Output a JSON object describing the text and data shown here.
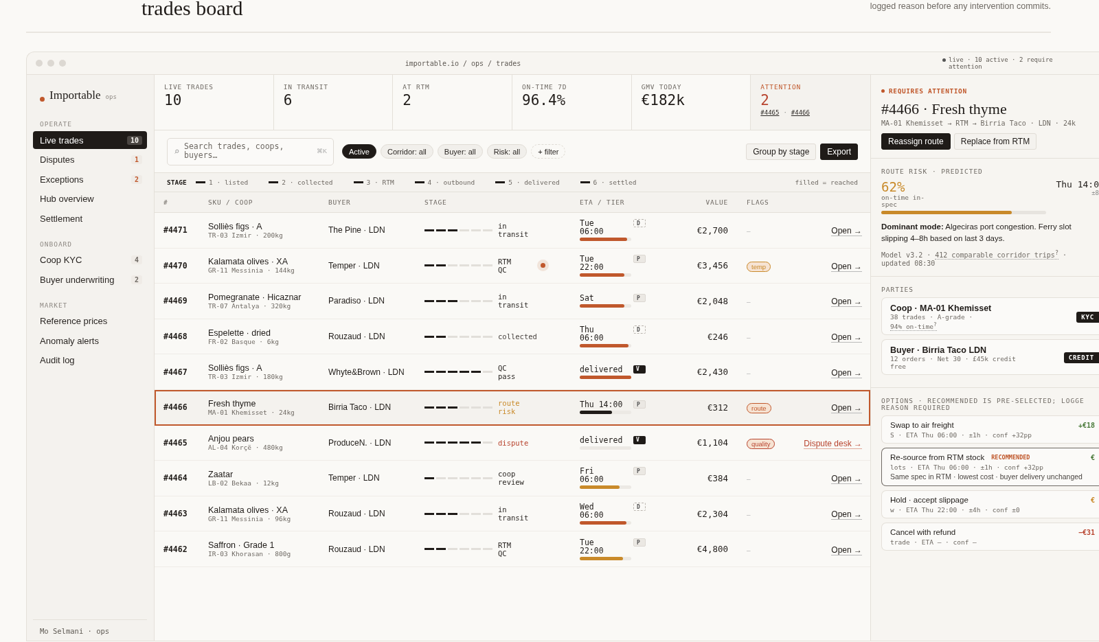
{
  "page": {
    "heading": "trades board",
    "note": "logged reason before any intervention commits."
  },
  "window": {
    "address": "importable.io / ops / trades",
    "status": "live · 10 active · 2 require attention"
  },
  "sidebar": {
    "brand": "Importable",
    "brand_tag": "ops",
    "sections": [
      {
        "title": "OPERATE",
        "items": [
          {
            "label": "Live trades",
            "count": "10",
            "selected": true
          },
          {
            "label": "Disputes",
            "count": "1",
            "color": "#c0582c",
            "selected": false
          },
          {
            "label": "Exceptions",
            "count": "2",
            "color": "#c0582c",
            "selected": false
          },
          {
            "label": "Hub overview",
            "selected": false
          },
          {
            "label": "Settlement",
            "selected": false
          }
        ]
      },
      {
        "title": "ONBOARD",
        "items": [
          {
            "label": "Coop KYC",
            "count": "4",
            "color": "#6f6a64",
            "selected": false
          },
          {
            "label": "Buyer underwriting",
            "count": "2",
            "color": "#6f6a64",
            "selected": false
          }
        ]
      },
      {
        "title": "MARKET",
        "items": [
          {
            "label": "Reference prices",
            "selected": false
          },
          {
            "label": "Anomaly alerts",
            "selected": false
          },
          {
            "label": "Audit log",
            "selected": false
          }
        ]
      }
    ],
    "user": "Mo Selmani · ops"
  },
  "kpis": [
    {
      "label": "LIVE TRADES",
      "value": "10",
      "kind": "normal"
    },
    {
      "label": "IN TRANSIT",
      "value": "6",
      "kind": "normal"
    },
    {
      "label": "AT RTM",
      "value": "2",
      "kind": "normal"
    },
    {
      "label": "ON-TIME 7D",
      "value": "96.4%",
      "kind": "normal"
    },
    {
      "label": "GMV TODAY",
      "value": "€182k",
      "kind": "normal"
    },
    {
      "label": "ATTENTION",
      "value": "2",
      "kind": "alert",
      "links": [
        "#4465",
        "#4466"
      ],
      "separator": "·"
    }
  ],
  "toolbar": {
    "search": {
      "placeholder": "Search trades, coops, buyers…",
      "shortcut": "⌘K"
    },
    "filters": [
      {
        "label": "Active",
        "kind": "chip",
        "selected": true
      },
      {
        "label": "Corridor: all",
        "kind": "chip",
        "selected": false
      },
      {
        "label": "Buyer: all",
        "kind": "chip",
        "selected": false
      },
      {
        "label": "Risk: all",
        "kind": "chip",
        "selected": false
      },
      {
        "label": "+ filter",
        "kind": "add",
        "selected": false
      }
    ],
    "buttons": [
      {
        "label": "Group by stage",
        "kind": "secondary"
      },
      {
        "label": "Export",
        "kind": "primary"
      }
    ]
  },
  "stage_legend": {
    "title": "STAGE",
    "steps": [
      "1 · listed",
      "2 · collected",
      "3 · RTM",
      "4 · outbound",
      "5 · delivered",
      "6 · settled"
    ],
    "note": "filled = reached"
  },
  "table": {
    "columns": [
      "#",
      "SKU / COOP",
      "BUYER",
      "STAGE",
      "ETA / TIER",
      "VALUE",
      "FLAGS"
    ],
    "rows": [
      {
        "id": "#4471",
        "sku": "Solliès figs · A",
        "coop": "TR-03 Izmir · 200kg",
        "buyer": "The Pine · LDN",
        "stage": {
          "level": 0.5,
          "label": "in transit",
          "color": "#2a2623",
          "alert_dot": false
        },
        "eta": {
          "day": "Tue",
          "time": "06:00",
          "tier": {
            "label": "D",
            "kind": "dashed"
          },
          "level": 0.92,
          "color": "#c0582c"
        },
        "value": "€2,700",
        "flag": {
          "text": "–",
          "kind": "none"
        },
        "action": {
          "label": "Open →",
          "kind": "link"
        },
        "selected": false
      },
      {
        "id": "#4470",
        "sku": "Kalamata olives · XA",
        "coop": "GR-11 Messinia · 144kg",
        "buyer": "Temper · LDN",
        "stage": {
          "level": 0.333,
          "label": "RTM QC",
          "color": "#2a2623",
          "alert_dot": true
        },
        "eta": {
          "day": "Tue",
          "time": "22:00",
          "tier": {
            "label": "P",
            "kind": "plain"
          },
          "level": 0.86,
          "color": "#c0582c"
        },
        "value": "€3,456",
        "flag": {
          "text": "temp",
          "kind": "tag",
          "color": "#c98a2a"
        },
        "action": {
          "label": "Open →",
          "kind": "link"
        },
        "selected": false
      },
      {
        "id": "#4469",
        "sku": "Pomegranate · Hicaznar",
        "coop": "TR-07 Antalya · 320kg",
        "buyer": "Paradiso · LDN",
        "stage": {
          "level": 0.5,
          "label": "in transit",
          "color": "#2a2623",
          "alert_dot": false
        },
        "eta": {
          "day": "Sat",
          "tier": {
            "label": "P",
            "kind": "plain"
          },
          "level": 0.86,
          "color": "#c0582c"
        },
        "value": "€2,048",
        "flag": {
          "text": "–",
          "kind": "none"
        },
        "action": {
          "label": "Open →",
          "kind": "link"
        },
        "selected": false
      },
      {
        "id": "#4468",
        "sku": "Espelette · dried",
        "coop": "FR-02 Basque · 6kg",
        "buyer": "Rouzaud · LDN",
        "stage": {
          "level": 0.333,
          "label": "collected",
          "color": "#4a4541",
          "alert_dot": false
        },
        "eta": {
          "day": "Thu",
          "time": "06:00",
          "tier": {
            "label": "D",
            "kind": "dashed"
          },
          "level": 0.95,
          "color": "#c0582c"
        },
        "value": "€246",
        "flag": {
          "text": "–",
          "kind": "none"
        },
        "action": {
          "label": "Open →",
          "kind": "link"
        },
        "selected": false
      },
      {
        "id": "#4467",
        "sku": "Solliès figs · A",
        "coop": "TR-03 Izmir · 180kg",
        "buyer": "Whyte&Brown · LDN",
        "stage": {
          "level": 0.833,
          "label": "QC pass",
          "color": "#2a2623",
          "alert_dot": false
        },
        "eta": {
          "day": "delivered",
          "tier": {
            "label": "V",
            "kind": "solid"
          },
          "level": 1,
          "color": "#c0582c"
        },
        "value": "€2,430",
        "flag": {
          "text": "–",
          "kind": "none"
        },
        "action": {
          "label": "Open →",
          "kind": "link"
        },
        "selected": false
      },
      {
        "id": "#4466",
        "sku": "Fresh thyme",
        "coop": "MA-01 Khemisset · 24kg",
        "buyer": "Birria Taco · LDN",
        "stage": {
          "level": 0.5,
          "label": "route risk",
          "color": "#c98a2a",
          "alert_dot": false
        },
        "eta": {
          "day": "Thu 14:00",
          "tier": {
            "label": "P",
            "kind": "plain"
          },
          "level": 0.62,
          "color": "#1f1b18"
        },
        "value": "€312",
        "flag": {
          "text": "route",
          "kind": "tag",
          "color": "#c0582c"
        },
        "action": {
          "label": "Open →",
          "kind": "link"
        },
        "selected": true
      },
      {
        "id": "#4465",
        "sku": "Anjou pears",
        "coop": "AL-04 Korçë · 480kg",
        "buyer": "ProduceN. · LDN",
        "stage": {
          "level": 0.833,
          "label": "dispute",
          "color": "#b8442f",
          "alert_dot": false
        },
        "eta": {
          "day": "delivered",
          "tier": {
            "label": "V",
            "kind": "solid"
          }
        },
        "value": "€1,104",
        "flag": {
          "text": "quality",
          "kind": "tag",
          "color": "#b8442f"
        },
        "action": {
          "label": "Dispute desk →",
          "kind": "alert"
        },
        "selected": false
      },
      {
        "id": "#4464",
        "sku": "Zaatar",
        "coop": "LB-02 Bekaa · 12kg",
        "buyer": "Temper · LDN",
        "stage": {
          "level": 0.167,
          "label": "coop review",
          "color": "#2a2623",
          "alert_dot": false
        },
        "eta": {
          "day": "Fri",
          "time": "06:00",
          "tier": {
            "label": "P",
            "kind": "plain"
          },
          "level": 0.77,
          "color": "#c98a2a"
        },
        "value": "€384",
        "flag": {
          "text": "–",
          "kind": "none"
        },
        "action": {
          "label": "Open →",
          "kind": "link"
        },
        "selected": false
      },
      {
        "id": "#4463",
        "sku": "Kalamata olives · XA",
        "coop": "GR-11 Messinia · 96kg",
        "buyer": "Rouzaud · LDN",
        "stage": {
          "level": 0.5,
          "label": "in transit",
          "color": "#2a2623",
          "alert_dot": false
        },
        "eta": {
          "day": "Wed",
          "time": "06:00",
          "tier": {
            "label": "D",
            "kind": "dashed"
          },
          "level": 0.91,
          "color": "#c0582c"
        },
        "value": "€2,304",
        "flag": {
          "text": "–",
          "kind": "none"
        },
        "action": {
          "label": "Open →",
          "kind": "link"
        },
        "selected": false
      },
      {
        "id": "#4462",
        "sku": "Saffron · Grade 1",
        "coop": "IR-03 Khorasan · 800g",
        "buyer": "Rouzaud · LDN",
        "stage": {
          "level": 0.333,
          "label": "RTM QC",
          "color": "#2a2623",
          "alert_dot": false
        },
        "eta": {
          "day": "Tue",
          "time": "22:00",
          "tier": {
            "label": "P",
            "kind": "plain"
          },
          "level": 0.84,
          "color": "#c98a2a"
        },
        "value": "€4,800",
        "flag": {
          "text": "–",
          "kind": "none"
        },
        "action": {
          "label": "Open →",
          "kind": "link"
        },
        "selected": false
      }
    ]
  },
  "detail": {
    "eyebrow": "REQUIRES ATTENTION",
    "title": "#4466 · Fresh thyme",
    "route": "MA-01 Khemisset → RTM → Birria Taco · LDN · 24k",
    "actions": [
      {
        "label": "Reassign route",
        "kind": "primary"
      },
      {
        "label": "Replace from RTM",
        "kind": "secondary"
      }
    ],
    "risk": {
      "label": "ROUTE RISK · PREDICTED",
      "value": "62%",
      "caption": "on-time in-spec",
      "eta": "Thu 14:0",
      "spread": "±8",
      "level": 0.79,
      "text": "**Dominant mode:** Algeciras port congestion. Ferry slot slipping 4–8h based on last 3 days.",
      "model_before": "Model v3.2 · ",
      "model_link": "412 comparable corridor trips$^{?}$",
      "model_after": " · updated 08:30"
    },
    "parties": {
      "title": "PARTIES",
      "items": [
        {
          "name": "Coop · MA-01 Khemisset",
          "meta": "38 trades · A-grade · ",
          "meta_link": "94% on-time$^{?}$",
          "badge": "KYC"
        },
        {
          "name": "Buyer · Birria Taco LDN",
          "meta": "12 orders · Net 30 · £45k credit free",
          "badge": "CREDIT"
        }
      ]
    },
    "options": {
      "title": "OPTIONS · RECOMMENDED IS PRE-SELECTED; LOGGE REASON REQUIRED",
      "items": [
        {
          "title": "Swap to air freight",
          "meta": "S · ETA Thu 06:00 · ±1h · conf +32pp",
          "delta": "+€18",
          "color": "#4a7a3a",
          "selected": false
        },
        {
          "title": "Re-source from RTM stock",
          "tag": "RECOMMENDED",
          "meta": "lots · ETA Thu 06:00 · ±1h · conf +32pp",
          "desc": "Same spec in RTM · lowest cost · buyer delivery unchanged",
          "delta": "€",
          "color": "#4a7a3a",
          "selected": true
        },
        {
          "title": "Hold · accept slippage",
          "meta": "w · ETA Thu 22:00 · ±4h · conf ±0",
          "delta": "€",
          "color": "#c98a2a",
          "selected": false
        },
        {
          "title": "Cancel with refund",
          "meta": "trade · ETA — · conf —",
          "delta": "−€31",
          "color": "#b8442f",
          "selected": false
        }
      ]
    }
  }
}
